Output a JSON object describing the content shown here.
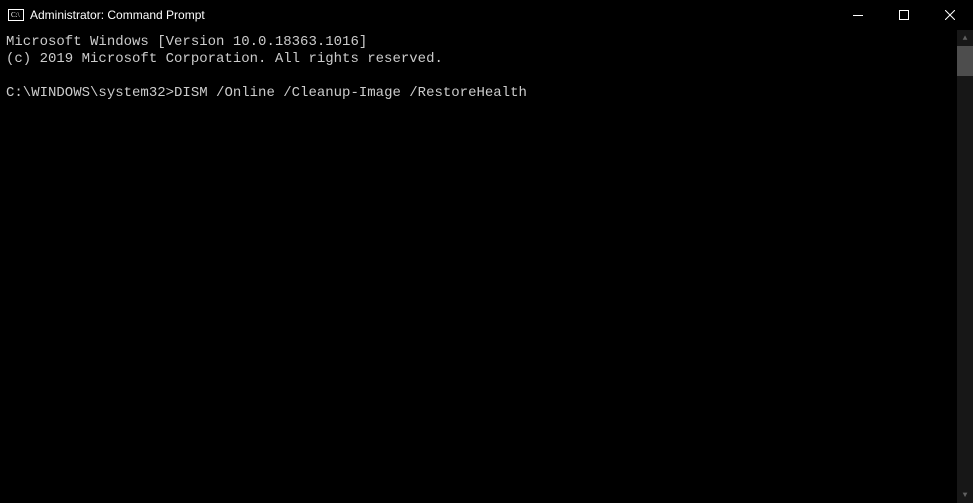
{
  "titlebar": {
    "title": "Administrator: Command Prompt"
  },
  "terminal": {
    "line1": "Microsoft Windows [Version 10.0.18363.1016]",
    "line2": "(c) 2019 Microsoft Corporation. All rights reserved.",
    "prompt": "C:\\WINDOWS\\system32>",
    "command": "DISM /Online /Cleanup-Image /RestoreHealth"
  }
}
